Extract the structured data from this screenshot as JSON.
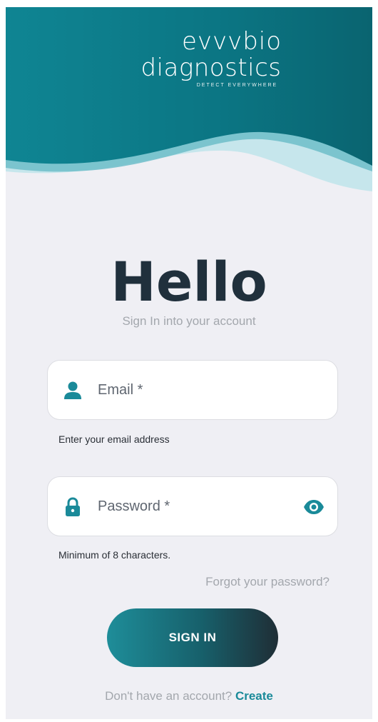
{
  "brand": {
    "logo_line1": "evvvbio",
    "logo_line2": "diagnostics",
    "tagline": "DETECT EVERYWHERE"
  },
  "heading": "Hello",
  "subtitle": "Sign In into your account",
  "email": {
    "placeholder": "Email *",
    "helper": "Enter your email address",
    "icon": "person-icon"
  },
  "password": {
    "placeholder": "Password *",
    "helper": "Minimum of 8 characters.",
    "icon": "lock-icon",
    "toggle_icon": "eye-icon"
  },
  "forgot_label": "Forgot your password?",
  "signin_label": "SIGN IN",
  "footer": {
    "prompt": "Don't have an account? ",
    "link": "Create"
  },
  "colors": {
    "brand_teal": "#1a8a99",
    "header_dark": "#0e7f8c",
    "heading_text": "#20303c",
    "background": "#efeff4"
  }
}
